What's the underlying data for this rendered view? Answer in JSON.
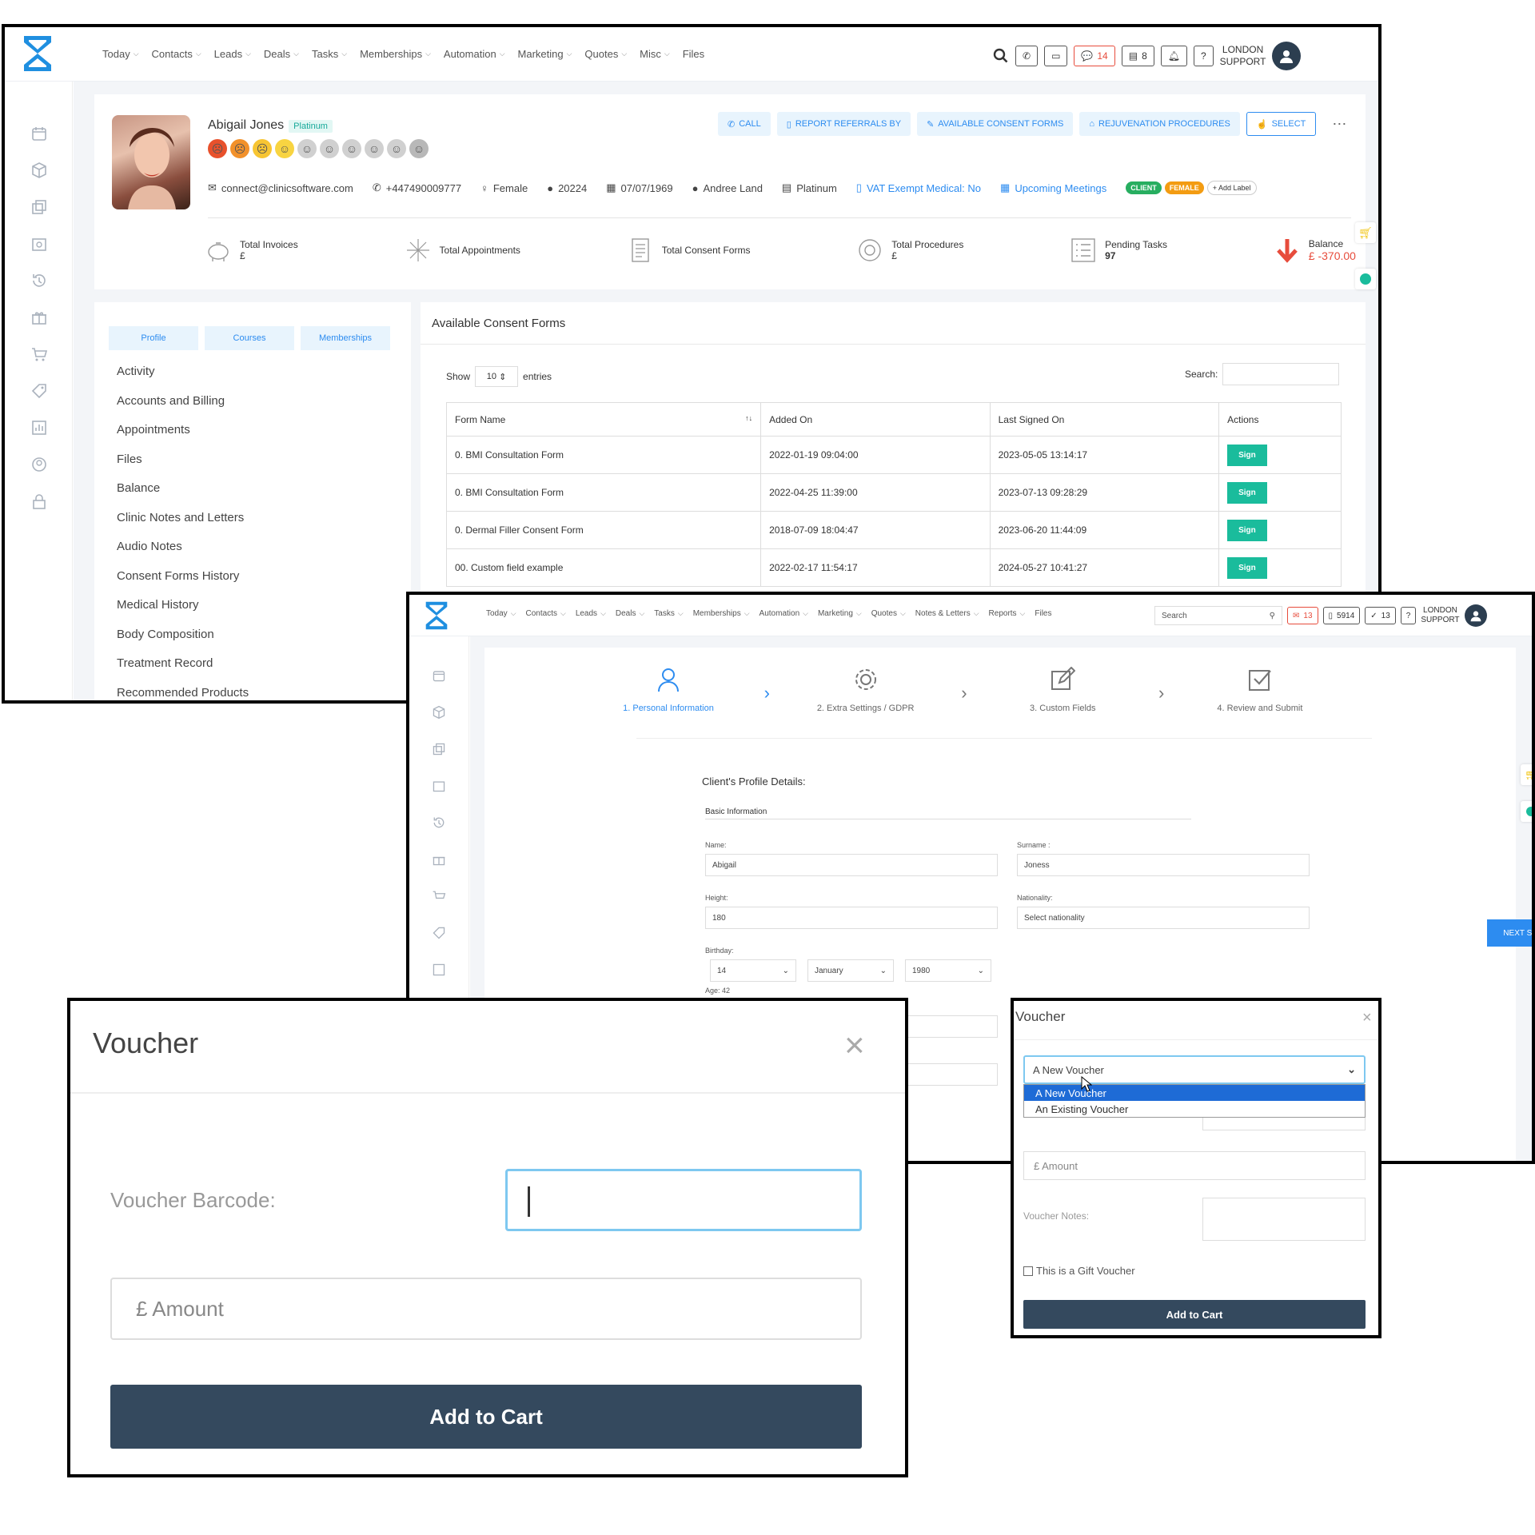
{
  "nav": {
    "items": [
      "Today",
      "Contacts",
      "Leads",
      "Deals",
      "Tasks",
      "Memberships",
      "Automation",
      "Marketing",
      "Quotes",
      "Misc",
      "Files"
    ],
    "items_w2": [
      "Today",
      "Contacts",
      "Leads",
      "Deals",
      "Tasks",
      "Memberships",
      "Automation",
      "Marketing",
      "Quotes",
      "Notes & Letters",
      "Reports",
      "Files"
    ]
  },
  "topbar": {
    "chat_count": "14",
    "store_count": "8",
    "support_line1": "LONDON",
    "support_line2": "SUPPORT",
    "w2_search_placeholder": "Search",
    "w2_mail_count": "13",
    "w2_sms_count": "5914",
    "w2_tasks_count": "13"
  },
  "profile": {
    "name": "Abigail Jones",
    "tier_badge": "Platinum",
    "email": "connect@clinicsoftware.com",
    "phone": "+447490009777",
    "gender": "Female",
    "client_id": "20224",
    "dob": "07/07/1969",
    "staff": "Andree Land",
    "membership": "Platinum",
    "vat": "VAT Exempt Medical: No",
    "meetings": "Upcoming Meetings",
    "labels": [
      "CLIENT",
      "FEMALE"
    ],
    "add_label": "+ Add Label",
    "actions": [
      "CALL",
      "REPORT REFERRALS BY",
      "AVAILABLE CONSENT FORMS",
      "REJUVENATION PROCEDURES",
      "SELECT"
    ],
    "stats": [
      {
        "label": "Total Invoices",
        "value": "£"
      },
      {
        "label": "Total Appointments",
        "value": ""
      },
      {
        "label": "Total Consent Forms",
        "value": ""
      },
      {
        "label": "Total Procedures",
        "value": "£"
      },
      {
        "label": "Pending Tasks",
        "value": "97"
      },
      {
        "label": "Balance",
        "value": "£ -370.00"
      }
    ],
    "colors": {
      "accent": "#2d8cf0",
      "teal": "#1abc9c",
      "balance": "#e74c3c",
      "client_label": "#27ae60",
      "female_label": "#f39c12"
    }
  },
  "profile_tabs": [
    "Profile",
    "Courses",
    "Memberships"
  ],
  "profile_menu": [
    "Activity",
    "Accounts and Billing",
    "Appointments",
    "Files",
    "Balance",
    "Clinic Notes and Letters",
    "Audio Notes",
    "Consent Forms History",
    "Medical History",
    "Body Composition",
    "Treatment Record",
    "Recommended Products"
  ],
  "consent": {
    "title": "Available Consent Forms",
    "show": "Show",
    "entries_value": "10",
    "entries": "entries",
    "search_label": "Search:",
    "headers": [
      "Form Name",
      "Added On",
      "Last Signed On",
      "Actions"
    ],
    "rows": [
      {
        "name": "0. BMI Consultation Form",
        "added": "2022-01-19 09:04:00",
        "signed": "2023-05-05 13:14:17",
        "action": "Sign"
      },
      {
        "name": "0. BMI Consultation Form",
        "added": "2022-04-25 11:39:00",
        "signed": "2023-07-13 09:28:29",
        "action": "Sign"
      },
      {
        "name": "0. Dermal Filler Consent Form",
        "added": "2018-07-09 18:04:47",
        "signed": "2023-06-20 11:44:09",
        "action": "Sign"
      },
      {
        "name": "00. Custom field example",
        "added": "2022-02-17 11:54:17",
        "signed": "2024-05-27 10:41:27",
        "action": "Sign"
      }
    ]
  },
  "wizard": {
    "steps": [
      "1. Personal Information",
      "2. Extra Settings / GDPR",
      "3. Custom Fields",
      "4. Review and Submit"
    ],
    "heading": "Client's Profile Details:",
    "section": "Basic Information",
    "name_label": "Name:",
    "name_value": "Abigail",
    "surname_label": "Surname :",
    "surname_value": "Joness",
    "height_label": "Height:",
    "height_value": "180",
    "nationality_label": "Nationality:",
    "nationality_value": "Select nationality",
    "birthday_label": "Birthday:",
    "bday_day": "14",
    "bday_month": "January",
    "bday_year": "1980",
    "age": "Age: 42",
    "next_step": "NEXT STEP"
  },
  "voucher_large": {
    "title": "Voucher",
    "close": "×",
    "barcode_label": "Voucher Barcode:",
    "amount_placeholder": "£ Amount",
    "add_to_cart": "Add to Cart"
  },
  "voucher_small": {
    "title": "Voucher",
    "close": "×",
    "selected": "A New Voucher",
    "options": [
      "A New Voucher",
      "An Existing Voucher"
    ],
    "amount_placeholder": "£ Amount",
    "notes_label": "Voucher Notes:",
    "gift_label": "This is a Gift Voucher",
    "add_to_cart": "Add to Cart"
  }
}
